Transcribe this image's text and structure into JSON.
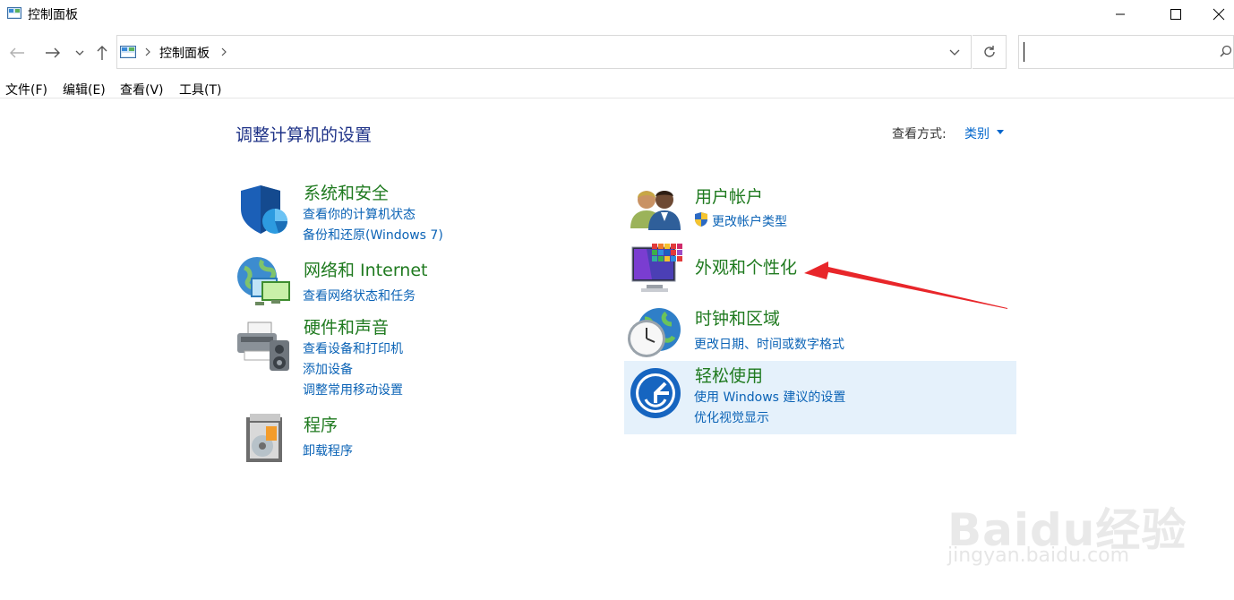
{
  "window": {
    "title": "控制面板"
  },
  "address": {
    "crumb": "控制面板"
  },
  "menu": [
    "文件(F)",
    "编辑(E)",
    "查看(V)",
    "工具(T)"
  ],
  "main": {
    "heading": "调整计算机的设置",
    "viewby_label": "查看方式:",
    "viewby_value": "类别"
  },
  "categories": {
    "system": {
      "title": "系统和安全",
      "links": [
        "查看你的计算机状态",
        "备份和还原(Windows 7)"
      ]
    },
    "network": {
      "title": "网络和 Internet",
      "links": [
        "查看网络状态和任务"
      ]
    },
    "hardware": {
      "title": "硬件和声音",
      "links": [
        "查看设备和打印机",
        "添加设备",
        "调整常用移动设置"
      ]
    },
    "programs": {
      "title": "程序",
      "links": [
        "卸载程序"
      ]
    },
    "users": {
      "title": "用户帐户",
      "links": [
        "更改帐户类型"
      ]
    },
    "appearance": {
      "title": "外观和个性化",
      "links": []
    },
    "clock": {
      "title": "时钟和区域",
      "links": [
        "更改日期、时间或数字格式"
      ]
    },
    "ease": {
      "title": "轻松使用",
      "links": [
        "使用 Windows 建议的设置",
        "优化视觉显示"
      ]
    }
  },
  "watermark": {
    "line1": "Baidu经验",
    "line2": "jingyan.baidu.com"
  },
  "colors": {
    "accent": "#0b63b6",
    "category": "#1f7a1f",
    "heading": "#1e3287",
    "highlight": "#e5f1fb",
    "arrow": "#e8262a"
  }
}
